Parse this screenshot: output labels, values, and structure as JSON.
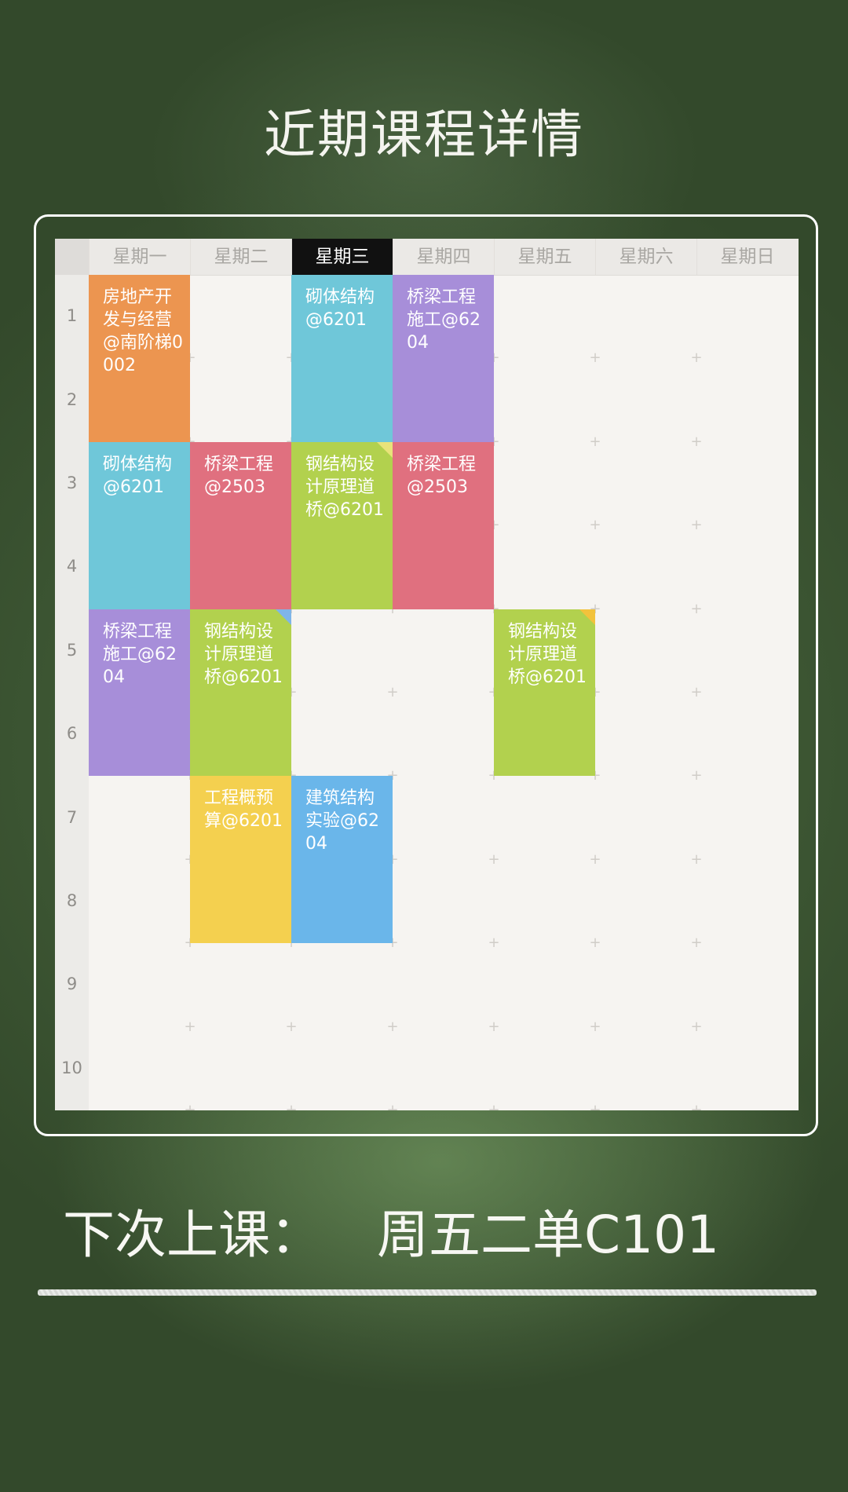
{
  "page": {
    "title": "近期课程详情"
  },
  "schedule": {
    "days": [
      "星期一",
      "星期二",
      "星期三",
      "星期四",
      "星期五",
      "星期六",
      "星期日"
    ],
    "active_day_index": 2,
    "periods": [
      "1",
      "2",
      "3",
      "4",
      "5",
      "6",
      "7",
      "8",
      "9",
      "10"
    ],
    "courses": [
      {
        "day": 0,
        "start": 1,
        "end": 2,
        "text": "房地产开发与经营@南阶梯0002",
        "color": "#ec9550"
      },
      {
        "day": 2,
        "start": 1,
        "end": 2,
        "text": "砌体结构@6201",
        "color": "#6fc7d9"
      },
      {
        "day": 3,
        "start": 1,
        "end": 2,
        "text": "桥梁工程施工@6204",
        "color": "#a78ed9"
      },
      {
        "day": 0,
        "start": 3,
        "end": 4,
        "text": "砌体结构@6201",
        "color": "#6fc7d9"
      },
      {
        "day": 1,
        "start": 3,
        "end": 4,
        "text": "桥梁工程@2503",
        "color": "#e0707f"
      },
      {
        "day": 2,
        "start": 3,
        "end": 4,
        "text": "钢结构设计原理道桥@6201",
        "color": "#b2d14e",
        "fold": "#e8e37a"
      },
      {
        "day": 3,
        "start": 3,
        "end": 4,
        "text": "桥梁工程@2503",
        "color": "#e0707f"
      },
      {
        "day": 0,
        "start": 5,
        "end": 6,
        "text": "桥梁工程施工@6204",
        "color": "#a78ed9"
      },
      {
        "day": 1,
        "start": 5,
        "end": 6,
        "text": "钢结构设计原理道桥@6201",
        "color": "#b2d14e",
        "fold": "#7fb5e8"
      },
      {
        "day": 4,
        "start": 5,
        "end": 6,
        "text": "钢结构设计原理道桥@6201",
        "color": "#b2d14e",
        "fold": "#f2c23c"
      },
      {
        "day": 1,
        "start": 7,
        "end": 8,
        "text": "工程概预算@6201",
        "color": "#f4d04f"
      },
      {
        "day": 2,
        "start": 7,
        "end": 8,
        "text": "建筑结构实验@6204",
        "color": "#6ab6ea"
      }
    ]
  },
  "next_class": {
    "label": "下次上课：",
    "value": "周五二单C101"
  }
}
